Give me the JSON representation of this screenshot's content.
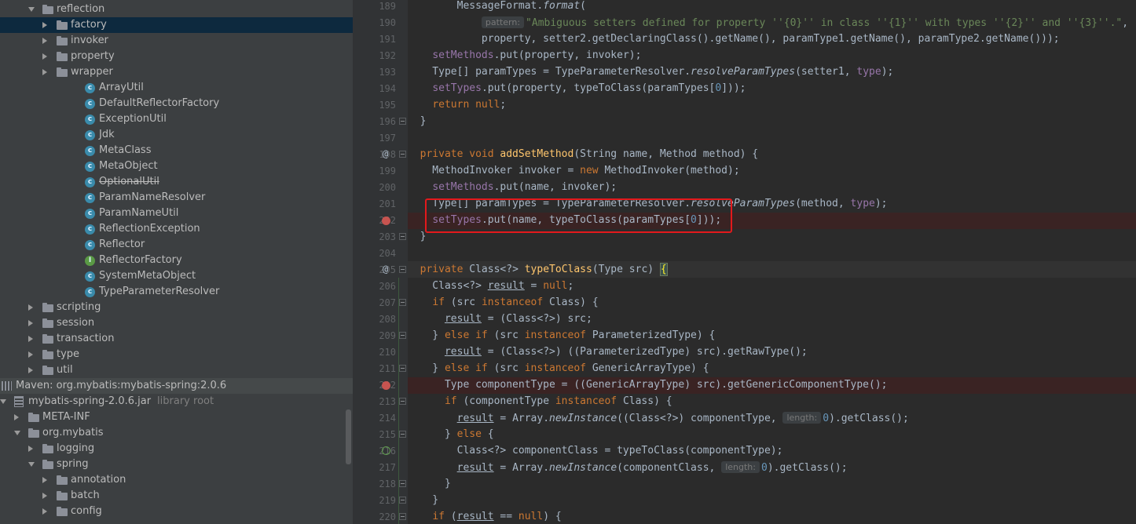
{
  "project_tree": {
    "rows": [
      {
        "label": "reflection",
        "icon": "folder",
        "arrow": "down",
        "indent": 0
      },
      {
        "label": "factory",
        "icon": "folder",
        "arrow": "right",
        "indent": 1,
        "selected": true
      },
      {
        "label": "invoker",
        "icon": "folder",
        "arrow": "right",
        "indent": 1
      },
      {
        "label": "property",
        "icon": "folder",
        "arrow": "right",
        "indent": 1
      },
      {
        "label": "wrapper",
        "icon": "folder",
        "arrow": "right",
        "indent": 1
      },
      {
        "label": "ArrayUtil",
        "icon": "class",
        "indent": 2
      },
      {
        "label": "DefaultReflectorFactory",
        "icon": "class",
        "indent": 2
      },
      {
        "label": "ExceptionUtil",
        "icon": "class",
        "indent": 2
      },
      {
        "label": "Jdk",
        "icon": "class",
        "indent": 2
      },
      {
        "label": "MetaClass",
        "icon": "class",
        "indent": 2
      },
      {
        "label": "MetaObject",
        "icon": "class",
        "indent": 2
      },
      {
        "label": "OptionalUtil",
        "icon": "class",
        "indent": 2,
        "strike": true
      },
      {
        "label": "ParamNameResolver",
        "icon": "class",
        "indent": 2
      },
      {
        "label": "ParamNameUtil",
        "icon": "class",
        "indent": 2
      },
      {
        "label": "ReflectionException",
        "icon": "class",
        "indent": 2
      },
      {
        "label": "Reflector",
        "icon": "class",
        "indent": 2
      },
      {
        "label": "ReflectorFactory",
        "icon": "interface",
        "indent": 2
      },
      {
        "label": "SystemMetaObject",
        "icon": "class",
        "indent": 2
      },
      {
        "label": "TypeParameterResolver",
        "icon": "class",
        "indent": 2
      },
      {
        "label": "scripting",
        "icon": "folder",
        "arrow": "right",
        "indent": 0
      },
      {
        "label": "session",
        "icon": "folder",
        "arrow": "right",
        "indent": 0
      },
      {
        "label": "transaction",
        "icon": "folder",
        "arrow": "right",
        "indent": 0
      },
      {
        "label": "type",
        "icon": "folder",
        "arrow": "right",
        "indent": 0
      },
      {
        "label": "util",
        "icon": "folder",
        "arrow": "right",
        "indent": 0
      },
      {
        "label": "Maven: org.mybatis:mybatis-spring:2.0.6",
        "icon": "library",
        "indent": -3,
        "maven": true
      },
      {
        "label": "mybatis-spring-2.0.6.jar",
        "sub": "library root",
        "icon": "jar",
        "arrow": "down",
        "indent": -2
      },
      {
        "label": "META-INF",
        "icon": "folder",
        "arrow": "right",
        "indent": -1
      },
      {
        "label": "org.mybatis",
        "icon": "folder",
        "arrow": "down",
        "indent": -1
      },
      {
        "label": "logging",
        "icon": "folder",
        "arrow": "right",
        "indent": 0
      },
      {
        "label": "spring",
        "icon": "folder",
        "arrow": "down",
        "indent": 0
      },
      {
        "label": "annotation",
        "icon": "folder",
        "arrow": "right",
        "indent": 1
      },
      {
        "label": "batch",
        "icon": "folder",
        "arrow": "right",
        "indent": 1
      },
      {
        "label": "config",
        "icon": "folder",
        "arrow": "right",
        "indent": 1
      }
    ]
  },
  "editor": {
    "lines": [
      {
        "n": "189",
        "html": "        MessageFormat.<span class=\"it\">format</span>("
      },
      {
        "n": "190",
        "html": "            <span class=\"hint\">pattern:</span><span class=\"str\">\"Ambiguous setters defined for property ''{0}'' in class ''{1}'' with types ''{2}'' and ''{3}''.\"</span>,"
      },
      {
        "n": "191",
        "html": "            property, setter2.getDeclaringClass().getName(), paramType1.getName(), paramType2.getName()));"
      },
      {
        "n": "192",
        "html": "    <span class=\"fld\">setMethods</span>.put(property, invoker);"
      },
      {
        "n": "193",
        "html": "    Type[] paramTypes = TypeParameterResolver.<span class=\"it\">resolveParamTypes</span>(setter1, <span class=\"fld\">type</span>);"
      },
      {
        "n": "194",
        "html": "    <span class=\"fld\">setTypes</span>.put(property, typeToClass(paramTypes[<span class=\"num\">0</span>]));"
      },
      {
        "n": "195",
        "html": "    <span class=\"kw\">return null</span>;"
      },
      {
        "n": "196",
        "html": "  }",
        "fold": true
      },
      {
        "n": "197",
        "html": ""
      },
      {
        "n": "198",
        "html": "  <span class=\"kw\">private void </span><span class=\"fn\">addSetMethod</span>(String name, Method method) {",
        "at": true,
        "fold": true
      },
      {
        "n": "199",
        "html": "    MethodInvoker invoker = <span class=\"kw\">new </span>MethodInvoker(method);"
      },
      {
        "n": "200",
        "html": "    <span class=\"fld\">setMethods</span>.put(name, invoker);"
      },
      {
        "n": "201",
        "html": "    Type[] paramTypes = TypeParameterResolver.<span class=\"it\">resolveParamTypes</span>(method, <span class=\"fld\">type</span>);"
      },
      {
        "n": "202",
        "html": "    <span class=\"fld\">setTypes</span>.put(name, typeToClass(paramTypes[<span class=\"num\">0</span>]));",
        "bp": true
      },
      {
        "n": "203",
        "html": "  }",
        "fold": true
      },
      {
        "n": "204",
        "html": ""
      },
      {
        "n": "205",
        "html": "  <span class=\"kw\">private </span>Class&lt;?&gt; <span class=\"fn\">typeToClass</span>(Type src) <span class=\"brace-hl\">{</span>",
        "at": true,
        "fold": true,
        "current": true
      },
      {
        "n": "206",
        "html": "    Class&lt;?&gt; <span class=\"ul\">result</span> = <span class=\"kw\">null</span>;"
      },
      {
        "n": "207",
        "html": "    <span class=\"kw\">if </span>(src <span class=\"kw\">instanceof </span>Class) {",
        "fold": true
      },
      {
        "n": "208",
        "html": "      <span class=\"ul\">result</span> = (Class&lt;?&gt;) src;"
      },
      {
        "n": "209",
        "html": "    } <span class=\"kw\">else if </span>(src <span class=\"kw\">instanceof </span>ParameterizedType) {",
        "fold": true
      },
      {
        "n": "210",
        "html": "      <span class=\"ul\">result</span> = (Class&lt;?&gt;) ((ParameterizedType) src).getRawType();"
      },
      {
        "n": "211",
        "html": "    } <span class=\"kw\">else if </span>(src <span class=\"kw\">instanceof </span>GenericArrayType) {",
        "fold": true
      },
      {
        "n": "212",
        "html": "      Type componentType = ((GenericArrayType) src).getGenericComponentType();",
        "bp": true
      },
      {
        "n": "213",
        "html": "      <span class=\"kw\">if </span>(componentType <span class=\"kw\">instanceof </span>Class) {",
        "fold": true
      },
      {
        "n": "214",
        "html": "        <span class=\"ul\">result</span> = Array.<span class=\"it\">newInstance</span>((Class&lt;?&gt;) componentType, <span class=\"hint\">length:</span><span class=\"num\">0</span>).getClass();"
      },
      {
        "n": "215",
        "html": "      } <span class=\"kw\">else </span>{",
        "fold": true
      },
      {
        "n": "216",
        "html": "        Class&lt;?&gt; componentClass = typeToClass(componentType);",
        "rec": true
      },
      {
        "n": "217",
        "html": "        <span class=\"ul\">result</span> = Array.<span class=\"it\">newInstance</span>(componentClass, <span class=\"hint\">length:</span><span class=\"num\">0</span>).getClass();"
      },
      {
        "n": "218",
        "html": "      }",
        "fold": true
      },
      {
        "n": "219",
        "html": "    }",
        "fold": true
      },
      {
        "n": "220",
        "html": "    <span class=\"kw\">if </span>(<span class=\"ul\">result</span> == <span class=\"kw\">null</span>) {",
        "fold": true
      }
    ]
  },
  "colors": {
    "tree_bg": "#3c3f41",
    "editor_bg": "#2b2b2b",
    "selection": "#0d293e",
    "highlight_box": "#e3191c",
    "breakpoint": "#c75450"
  }
}
